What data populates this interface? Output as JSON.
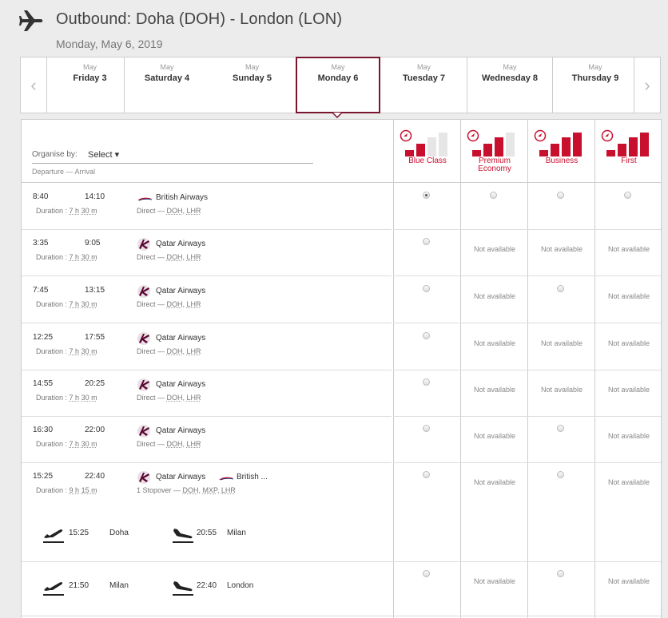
{
  "header": {
    "title": "Outbound: Doha (DOH) - London (LON)",
    "subtitle": "Monday, May 6, 2019"
  },
  "dates": [
    {
      "month": "May",
      "day": "Friday 3"
    },
    {
      "month": "May",
      "day": "Saturday 4"
    },
    {
      "month": "May",
      "day": "Sunday 5"
    },
    {
      "month": "May",
      "day": "Monday 6",
      "selected": true
    },
    {
      "month": "May",
      "day": "Tuesday 7"
    },
    {
      "month": "May",
      "day": "Wednesday 8"
    },
    {
      "month": "May",
      "day": "Thursday 9"
    }
  ],
  "table": {
    "organise_label": "Organise by:",
    "organise_value": "Select ▾",
    "dep_arr_label": "Departure — Arrival",
    "fares": [
      {
        "label": "Blue Class",
        "level": 2
      },
      {
        "label": "Premium Economy",
        "level": 3
      },
      {
        "label": "Business",
        "level": 4
      },
      {
        "label": "First",
        "level": 4
      }
    ],
    "not_available": "Not available",
    "flights": [
      {
        "dep": "8:40",
        "arr": "14:10",
        "dur_h": "7",
        "dur_m": "30",
        "airline": "British Airways",
        "logo": "ba",
        "route_type": "Direct",
        "route": [
          "DOH",
          "LHR"
        ],
        "avail": [
          "checked",
          "radio",
          "radio",
          "radio"
        ]
      },
      {
        "dep": "3:35",
        "arr": "9:05",
        "dur_h": "7",
        "dur_m": "30",
        "airline": "Qatar Airways",
        "logo": "qr",
        "route_type": "Direct",
        "route": [
          "DOH",
          "LHR"
        ],
        "avail": [
          "radio",
          "na",
          "na",
          "na"
        ]
      },
      {
        "dep": "7:45",
        "arr": "13:15",
        "dur_h": "7",
        "dur_m": "30",
        "airline": "Qatar Airways",
        "logo": "qr",
        "route_type": "Direct",
        "route": [
          "DOH",
          "LHR"
        ],
        "avail": [
          "radio",
          "na",
          "radio",
          "na"
        ]
      },
      {
        "dep": "12:25",
        "arr": "17:55",
        "dur_h": "7",
        "dur_m": "30",
        "airline": "Qatar Airways",
        "logo": "qr",
        "route_type": "Direct",
        "route": [
          "DOH",
          "LHR"
        ],
        "avail": [
          "radio",
          "na",
          "na",
          "na"
        ]
      },
      {
        "dep": "14:55",
        "arr": "20:25",
        "dur_h": "7",
        "dur_m": "30",
        "airline": "Qatar Airways",
        "logo": "qr",
        "route_type": "Direct",
        "route": [
          "DOH",
          "LHR"
        ],
        "avail": [
          "radio",
          "na",
          "na",
          "na"
        ]
      },
      {
        "dep": "16:30",
        "arr": "22:00",
        "dur_h": "7",
        "dur_m": "30",
        "airline": "Qatar Airways",
        "logo": "qr",
        "route_type": "Direct",
        "route": [
          "DOH",
          "LHR"
        ],
        "avail": [
          "radio",
          "na",
          "radio",
          "na"
        ]
      },
      {
        "dep": "15:25",
        "arr": "22:40",
        "dur_h": "9",
        "dur_m": "15",
        "airline": "Qatar Airways",
        "airline2": "British ...",
        "logo": "qr",
        "route_type": "1 Stopover",
        "route": [
          "DOH",
          "MXP",
          "LHR"
        ],
        "avail": [
          "radio",
          "na",
          "radio",
          "na"
        ],
        "legs": [
          {
            "dep_time": "15:25",
            "dep_city": "Doha",
            "arr_time": "20:55",
            "arr_city": "Milan"
          },
          {
            "dep_time": "21:50",
            "dep_city": "Milan",
            "arr_time": "22:40",
            "arr_city": "London"
          }
        ]
      }
    ],
    "leg2_avail": [
      "radio",
      "na",
      "radio",
      "na"
    ]
  },
  "colors": {
    "brand": "#c8102e",
    "selected_border": "#7a1530"
  }
}
